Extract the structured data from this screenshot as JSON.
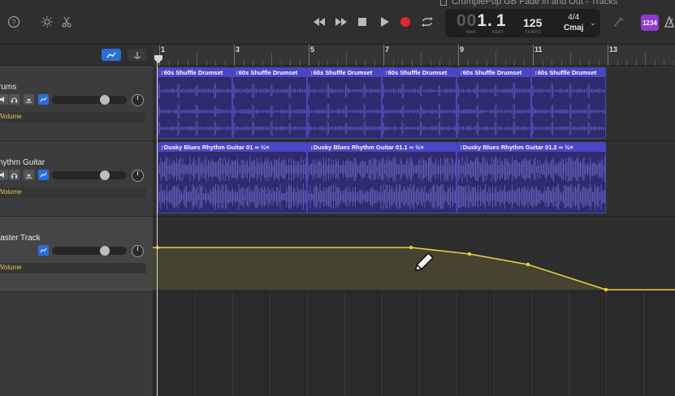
{
  "window": {
    "title": "CrumplePop GB Fade in and Out - Tracks"
  },
  "toolbar": {
    "lcd": {
      "bar_dim": "00",
      "bar": "1",
      "beat": "1",
      "bar_label": "BAR",
      "beat_label": "BEAT",
      "tempo": "125",
      "tempo_label": "TEMPO",
      "signature": "4/4",
      "key": "Cmaj"
    },
    "count_in_badge": "1234",
    "icons": [
      "help-icon",
      "brightness-icon",
      "scissors-icon",
      "rewind-icon",
      "fast-forward-icon",
      "stop-icon",
      "play-icon",
      "record-icon",
      "cycle-icon",
      "tuner-icon",
      "metronome-icon"
    ]
  },
  "ruler": {
    "bars": [
      "1",
      "3",
      "5",
      "7",
      "9",
      "11",
      "13"
    ]
  },
  "tracks": [
    {
      "name": "Drums",
      "display_name": "rums",
      "automation": "Volume"
    },
    {
      "name": "Rhythm Guitar",
      "display_name": "hythm Guitar",
      "automation": "Volume"
    },
    {
      "name": "Master Track",
      "display_name": "laster Track",
      "automation": "Volume"
    }
  ],
  "regions": {
    "drums": [
      "60s Shuffle Drumset",
      "60s Shuffle Drumset",
      "60s Shuffle Drumset",
      "60s Shuffle Drumset",
      "60s Shuffle Drumset",
      "60s Shuffle Drumset"
    ],
    "guitar": [
      "Dusky Blues Rhythm Guitar 01",
      "Dusky Blues Rhythm Guitar 01.1",
      "Dusky Blues Rhythm Guitar 01.2"
    ],
    "guitar_tag": "½×"
  },
  "colors": {
    "accent_blue": "#2b6fd6",
    "region": "#2e2b6e",
    "region_header": "#4a46c4",
    "automation": "#e8d23a",
    "record": "#e0282e",
    "badge": "#8d3bd1"
  }
}
